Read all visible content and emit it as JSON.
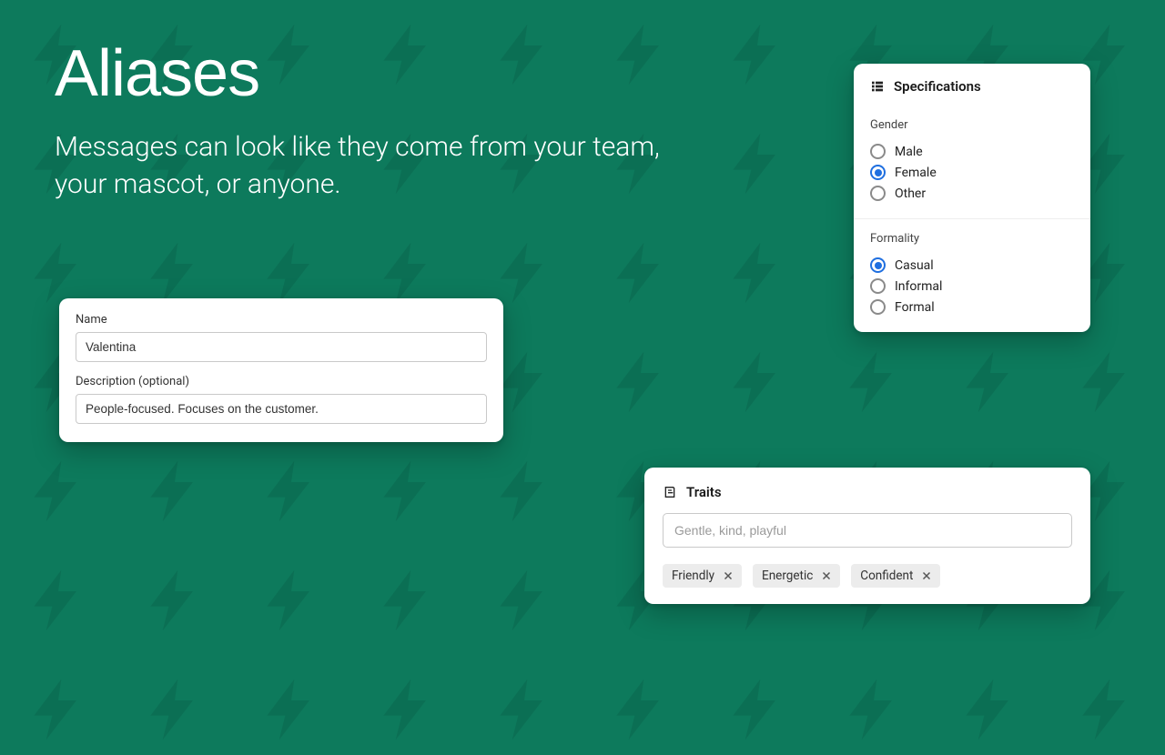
{
  "hero": {
    "title": "Aliases",
    "subtitle": "Messages can look like they come from your team, your mascot, or anyone."
  },
  "nameCard": {
    "nameLabel": "Name",
    "nameValue": "Valentina",
    "descLabel": "Description (optional)",
    "descValue": "People-focused. Focuses on the customer."
  },
  "specs": {
    "title": "Specifications",
    "gender": {
      "label": "Gender",
      "options": {
        "male": "Male",
        "female": "Female",
        "other": "Other"
      },
      "selected": "female"
    },
    "formality": {
      "label": "Formality",
      "options": {
        "casual": "Casual",
        "informal": "Informal",
        "formal": "Formal"
      },
      "selected": "casual"
    }
  },
  "traits": {
    "title": "Traits",
    "placeholder": "Gentle, kind, playful",
    "tags": {
      "friendly": "Friendly",
      "energetic": "Energetic",
      "confident": "Confident"
    }
  }
}
